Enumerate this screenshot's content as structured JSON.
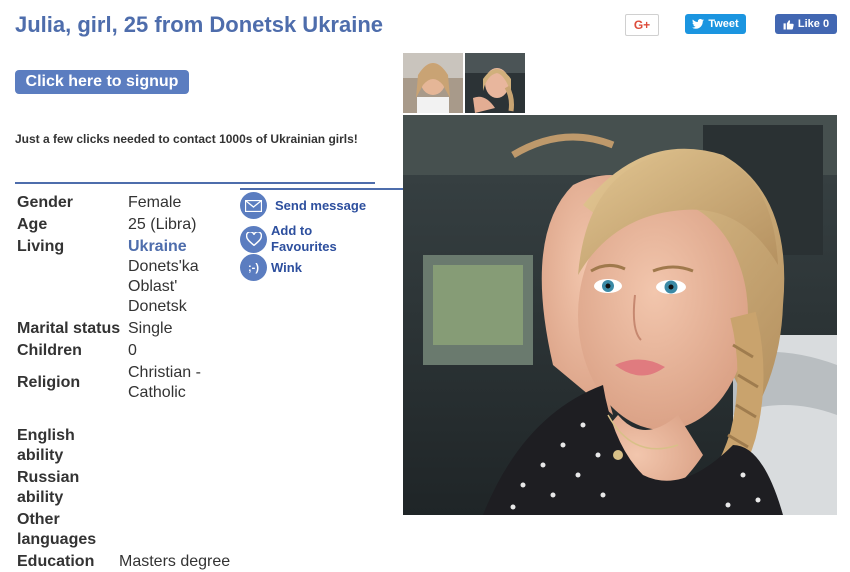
{
  "header": {
    "title": "Julia, girl, 25 from Donetsk Ukraine",
    "gplus_label": "G+",
    "tweet_label": "Tweet",
    "like_label": "Like 0"
  },
  "signup": {
    "button_label": "Click here to signup",
    "tagline": "Just a few clicks needed to contact 1000s of Ukrainian girls!"
  },
  "profile": {
    "gender_label": "Gender",
    "gender": "Female",
    "age_label": "Age",
    "age": "25 (Libra)",
    "living_label": "Living",
    "country": "Ukraine",
    "region": "Donets'ka Oblast'",
    "city": "Donetsk",
    "marital_label": "Marital status",
    "marital": "Single",
    "children_label": "Children",
    "children": "0",
    "religion_label": "Religion",
    "religion": "Christian - Catholic",
    "english_label": "English ability",
    "russian_label": "Russian ability",
    "other_label": "Other languages",
    "education_label": "Education",
    "education": "Masters degree"
  },
  "actions": {
    "send_message": "Send message",
    "favourites": "Add to Favourites",
    "wink": "Wink",
    "wink_glyph": ";-)"
  },
  "icons": [
    "envelope-icon",
    "heart-icon",
    "wink-icon",
    "twitter-bird-icon",
    "thumbs-up-icon"
  ],
  "colors": {
    "accent": "#4e6dac",
    "button": "#5b7dc0",
    "twitter": "#1b95e0",
    "facebook": "#4267b2"
  }
}
